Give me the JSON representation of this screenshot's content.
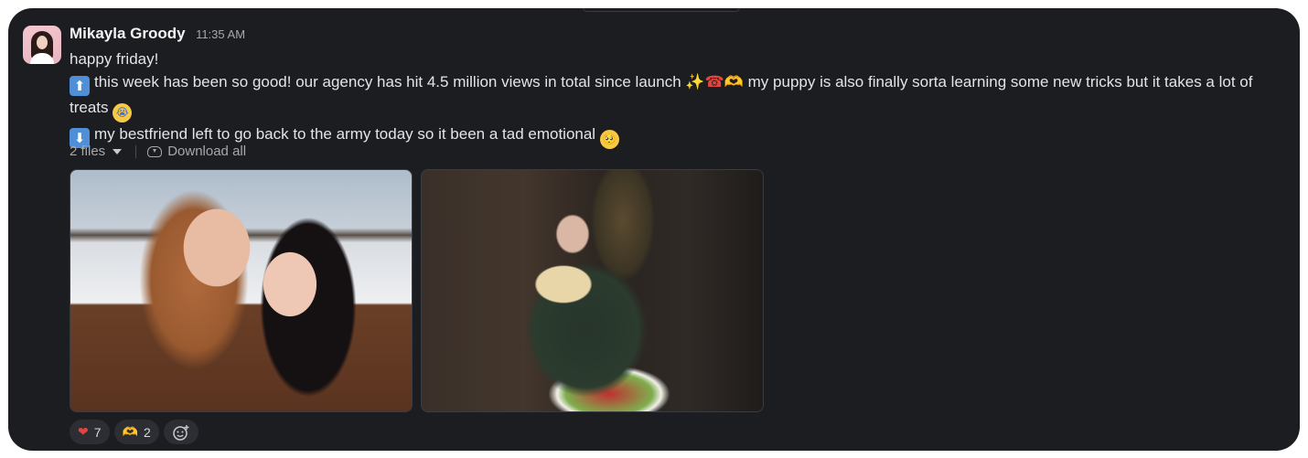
{
  "message": {
    "sender": "Mikayla Groody",
    "timestamp": "11:35 AM",
    "avatar_icon": "avatar-photo",
    "lines": {
      "line1": "happy friday!",
      "line2_emoji": "⬆",
      "line2_text": "this week has been so good! our agency has hit 4.5 million views in total since launch",
      "line2_emojis": [
        "✨",
        "☎",
        "🫶"
      ],
      "line2_text_b": " my puppy is also finally sorta learning some new tricks but it takes a lot of treats ",
      "line2_end_emoji": "😭",
      "line3_emoji": "⬇",
      "line3_text": "my bestfriend left to go back to the army today so it been a tad emotional ",
      "line3_end_emoji": "🥺"
    }
  },
  "files": {
    "count_label": "2 files",
    "download_label": "Download all",
    "attachments": [
      {
        "name": "selfie-photo",
        "description_icon": "image"
      },
      {
        "name": "puppy-photo",
        "description_icon": "image"
      }
    ]
  },
  "reactions": [
    {
      "emoji": "❤",
      "count": "7",
      "name": "heart"
    },
    {
      "emoji": "🫶",
      "count": "2",
      "name": "heart-hands"
    }
  ],
  "colors": {
    "background": "#1b1d21",
    "text": "#e3e4e6",
    "muted": "#a7a8ab",
    "reaction_bg": "#2c2e33"
  }
}
